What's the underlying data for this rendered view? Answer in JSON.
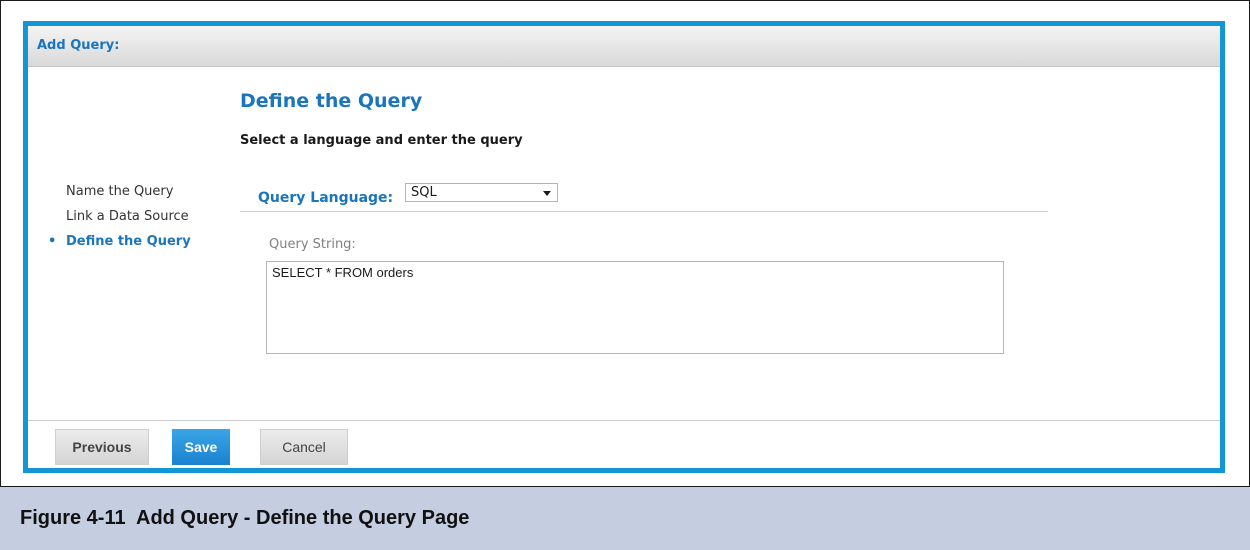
{
  "dialog": {
    "title": "Add Query:"
  },
  "wizard": {
    "steps": [
      {
        "label": "Name the Query",
        "active": false
      },
      {
        "label": "Link a Data Source",
        "active": false
      },
      {
        "label": "Define the Query",
        "active": true
      }
    ],
    "bullet": "•"
  },
  "section": {
    "title": "Define the Query",
    "subtitle": "Select a language and enter the query"
  },
  "query_language": {
    "label": "Query Language:",
    "selected": "SQL",
    "icon": "chevron-down-icon"
  },
  "query_string": {
    "label": "Query String:",
    "value": "SELECT * FROM orders"
  },
  "footer": {
    "previous_label": "Previous",
    "save_label": "Save",
    "cancel_label": "Cancel"
  },
  "caption": {
    "number": "Figure 4-11",
    "text": "Add Query - Define the Query Page"
  },
  "colors": {
    "accent": "#1b75bc",
    "dialog_border": "#1296d6",
    "save_button": "#1a82cf",
    "caption_background": "#c5cde0"
  }
}
